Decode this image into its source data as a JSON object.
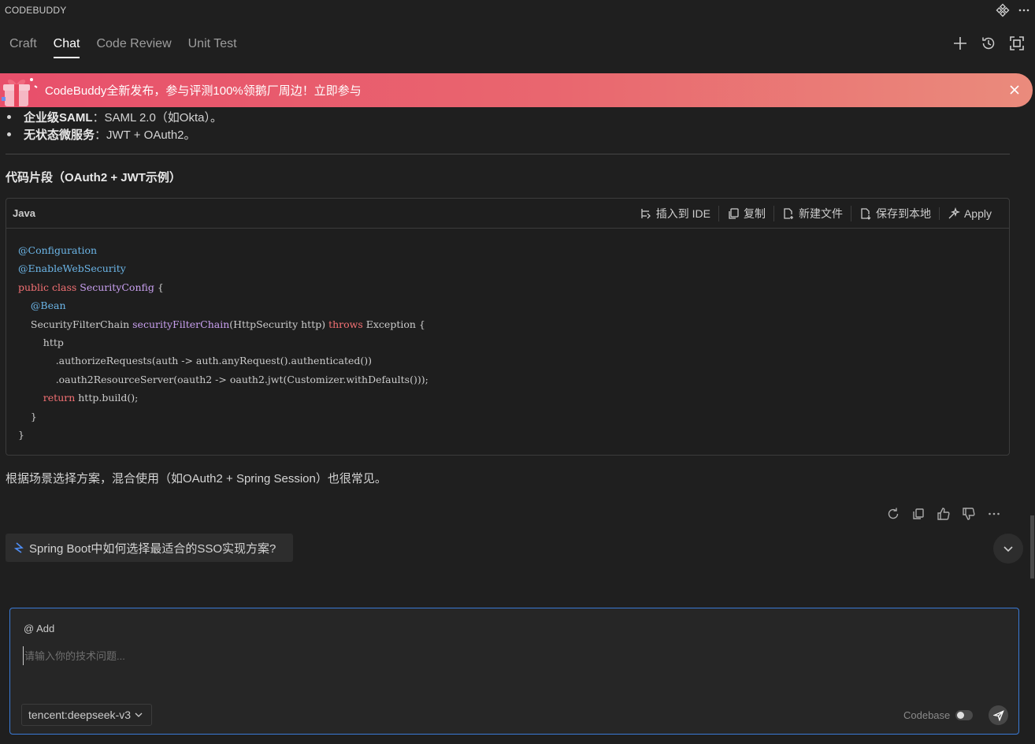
{
  "app": {
    "title": "CODEBUDDY"
  },
  "tabs": [
    {
      "label": "Craft",
      "active": false
    },
    {
      "label": "Chat",
      "active": true
    },
    {
      "label": "Code Review",
      "active": false
    },
    {
      "label": "Unit Test",
      "active": false
    }
  ],
  "banner": {
    "text": "CodeBuddy全新发布，参与评测100%领鹅厂周边！立即参与"
  },
  "chat": {
    "bullets": [
      {
        "bold": "企业级SAML",
        "text": "：SAML 2.0（如Okta）。"
      },
      {
        "bold": "无状态微服务",
        "text": "：JWT + OAuth2。"
      }
    ],
    "section_title": "代码片段（OAuth2 + JWT示例）",
    "code": {
      "language": "Java",
      "actions": {
        "insert": "插入到 IDE",
        "copy": "复制",
        "new_file": "新建文件",
        "save_local": "保存到本地",
        "apply": "Apply"
      },
      "lines": {
        "l1": "@Configuration",
        "l2": "@EnableWebSecurity",
        "l3_kw": "public class",
        "l3_name": "SecurityConfig",
        "l3_rest": " {",
        "l4": "@Bean",
        "l5_type": "SecurityFilterChain ",
        "l5_fn": "securityFilterChain",
        "l5_args": "(HttpSecurity http) ",
        "l5_kw": "throws",
        "l5_rest": " Exception {",
        "l6": "http",
        "l7": ".authorizeRequests(auth -> auth.anyRequest().authenticated())",
        "l8": ".oauth2ResourceServer(oauth2 -> oauth2.jwt(Customizer.withDefaults()));",
        "l9_kw": "return",
        "l9_rest": " http.build();",
        "l10": "}",
        "l11": "}"
      }
    },
    "summary": "根据场景选择方案，混合使用（如OAuth2 + Spring Session）也很常见。",
    "suggestion": "Spring Boot中如何选择最适合的SSO实现方案?"
  },
  "input": {
    "add_label": "@ Add",
    "placeholder": "请输入你的技术问题...",
    "value": "",
    "model": "tencent:deepseek-v3",
    "codebase_label": "Codebase",
    "codebase_enabled": false
  },
  "colors": {
    "accent": "#3a7ad6",
    "banner_start": "#e84f6b",
    "banner_end": "#ea8b7c",
    "keyword": "#f47174",
    "annotation": "#6cb6e8",
    "type": "#c9a0f0"
  },
  "icons": {
    "top": [
      "codebuddy-logo-icon",
      "more-icon"
    ],
    "tab_actions": [
      "new-chat-icon",
      "history-icon",
      "expand-icon"
    ],
    "message_actions": [
      "regenerate-icon",
      "copy-icon",
      "thumbs-up-icon",
      "thumbs-down-icon",
      "more-icon"
    ]
  }
}
